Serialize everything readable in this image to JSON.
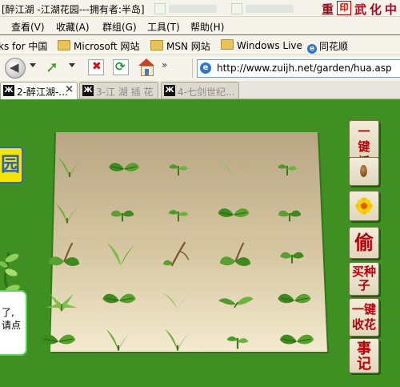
{
  "window": {
    "title": "[醉江湖 -江湖花园---拥有者:半岛]"
  },
  "brand": {
    "chars": [
      "重",
      "武",
      "化",
      "中"
    ]
  },
  "menu": {
    "items": [
      "查看(V)",
      "收藏(A)",
      "群组(G)",
      "工具(T)",
      "帮助(H)"
    ]
  },
  "favorites": {
    "items": [
      {
        "label": "ks for 中国",
        "icon": "none"
      },
      {
        "label": "Microsoft 网站",
        "icon": "folder-icon"
      },
      {
        "label": "MSN 网站",
        "icon": "folder-icon"
      },
      {
        "label": "Windows Live",
        "icon": "folder-icon"
      },
      {
        "label": "同花顺",
        "icon": "ie-icon"
      }
    ]
  },
  "toolbar": {
    "chevron": "»",
    "address": "http://www.zuijh.net/garden/hua.asp"
  },
  "tabs": [
    {
      "label": "2-醉江湖-...",
      "active": true,
      "close": "×"
    },
    {
      "label": "3-江 湖 插 花",
      "active": false
    },
    {
      "label": "4-七剑世纪...",
      "active": false
    }
  ],
  "page": {
    "garden_badge": "园",
    "tip_text": [
      "了,",
      "请点"
    ],
    "actions": [
      {
        "id": "plant-all",
        "label": "一键播种"
      },
      {
        "id": "seed",
        "label": ""
      },
      {
        "id": "flower",
        "label": ""
      },
      {
        "id": "steal",
        "label": "偷"
      },
      {
        "id": "buy",
        "label": "买种子"
      },
      {
        "id": "harvest",
        "label": "一键收花"
      },
      {
        "id": "log",
        "label": "事记"
      }
    ],
    "plots": [
      [
        "sprout-v",
        "leaf-pair",
        "tiny-sprout",
        "thin-v",
        "tiny-sprout"
      ],
      [
        "sprout-v",
        "small-sprout",
        "tiny-sprout",
        "leaf-pair",
        "small-sprout"
      ],
      [
        "vine-leaf",
        "sprout-v-big",
        "vine-stick",
        "vine-leaf",
        "small-sprout"
      ],
      [
        "star-leaf",
        "leaf-pair",
        "thin-v",
        "spread-leaf",
        "leaf-pair"
      ],
      [
        "leaf-pair",
        "sprout-v",
        "sprout-v",
        "tiny-sprout",
        "leaf-pair"
      ]
    ]
  }
}
